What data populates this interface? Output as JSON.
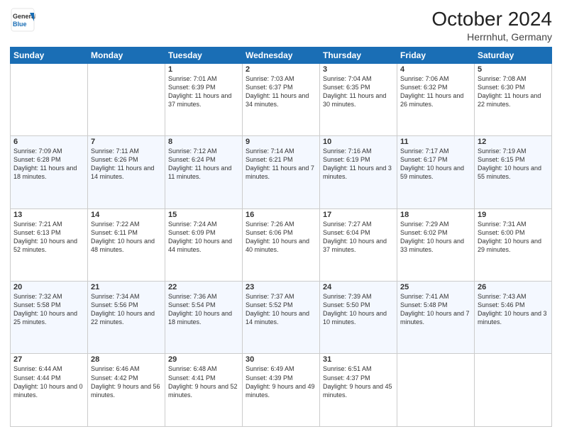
{
  "header": {
    "logo_line1": "General",
    "logo_line2": "Blue",
    "title": "October 2024",
    "location": "Herrnhut, Germany"
  },
  "weekdays": [
    "Sunday",
    "Monday",
    "Tuesday",
    "Wednesday",
    "Thursday",
    "Friday",
    "Saturday"
  ],
  "weeks": [
    [
      {
        "day": "",
        "sunrise": "",
        "sunset": "",
        "daylight": ""
      },
      {
        "day": "",
        "sunrise": "",
        "sunset": "",
        "daylight": ""
      },
      {
        "day": "1",
        "sunrise": "Sunrise: 7:01 AM",
        "sunset": "Sunset: 6:39 PM",
        "daylight": "Daylight: 11 hours and 37 minutes."
      },
      {
        "day": "2",
        "sunrise": "Sunrise: 7:03 AM",
        "sunset": "Sunset: 6:37 PM",
        "daylight": "Daylight: 11 hours and 34 minutes."
      },
      {
        "day": "3",
        "sunrise": "Sunrise: 7:04 AM",
        "sunset": "Sunset: 6:35 PM",
        "daylight": "Daylight: 11 hours and 30 minutes."
      },
      {
        "day": "4",
        "sunrise": "Sunrise: 7:06 AM",
        "sunset": "Sunset: 6:32 PM",
        "daylight": "Daylight: 11 hours and 26 minutes."
      },
      {
        "day": "5",
        "sunrise": "Sunrise: 7:08 AM",
        "sunset": "Sunset: 6:30 PM",
        "daylight": "Daylight: 11 hours and 22 minutes."
      }
    ],
    [
      {
        "day": "6",
        "sunrise": "Sunrise: 7:09 AM",
        "sunset": "Sunset: 6:28 PM",
        "daylight": "Daylight: 11 hours and 18 minutes."
      },
      {
        "day": "7",
        "sunrise": "Sunrise: 7:11 AM",
        "sunset": "Sunset: 6:26 PM",
        "daylight": "Daylight: 11 hours and 14 minutes."
      },
      {
        "day": "8",
        "sunrise": "Sunrise: 7:12 AM",
        "sunset": "Sunset: 6:24 PM",
        "daylight": "Daylight: 11 hours and 11 minutes."
      },
      {
        "day": "9",
        "sunrise": "Sunrise: 7:14 AM",
        "sunset": "Sunset: 6:21 PM",
        "daylight": "Daylight: 11 hours and 7 minutes."
      },
      {
        "day": "10",
        "sunrise": "Sunrise: 7:16 AM",
        "sunset": "Sunset: 6:19 PM",
        "daylight": "Daylight: 11 hours and 3 minutes."
      },
      {
        "day": "11",
        "sunrise": "Sunrise: 7:17 AM",
        "sunset": "Sunset: 6:17 PM",
        "daylight": "Daylight: 10 hours and 59 minutes."
      },
      {
        "day": "12",
        "sunrise": "Sunrise: 7:19 AM",
        "sunset": "Sunset: 6:15 PM",
        "daylight": "Daylight: 10 hours and 55 minutes."
      }
    ],
    [
      {
        "day": "13",
        "sunrise": "Sunrise: 7:21 AM",
        "sunset": "Sunset: 6:13 PM",
        "daylight": "Daylight: 10 hours and 52 minutes."
      },
      {
        "day": "14",
        "sunrise": "Sunrise: 7:22 AM",
        "sunset": "Sunset: 6:11 PM",
        "daylight": "Daylight: 10 hours and 48 minutes."
      },
      {
        "day": "15",
        "sunrise": "Sunrise: 7:24 AM",
        "sunset": "Sunset: 6:09 PM",
        "daylight": "Daylight: 10 hours and 44 minutes."
      },
      {
        "day": "16",
        "sunrise": "Sunrise: 7:26 AM",
        "sunset": "Sunset: 6:06 PM",
        "daylight": "Daylight: 10 hours and 40 minutes."
      },
      {
        "day": "17",
        "sunrise": "Sunrise: 7:27 AM",
        "sunset": "Sunset: 6:04 PM",
        "daylight": "Daylight: 10 hours and 37 minutes."
      },
      {
        "day": "18",
        "sunrise": "Sunrise: 7:29 AM",
        "sunset": "Sunset: 6:02 PM",
        "daylight": "Daylight: 10 hours and 33 minutes."
      },
      {
        "day": "19",
        "sunrise": "Sunrise: 7:31 AM",
        "sunset": "Sunset: 6:00 PM",
        "daylight": "Daylight: 10 hours and 29 minutes."
      }
    ],
    [
      {
        "day": "20",
        "sunrise": "Sunrise: 7:32 AM",
        "sunset": "Sunset: 5:58 PM",
        "daylight": "Daylight: 10 hours and 25 minutes."
      },
      {
        "day": "21",
        "sunrise": "Sunrise: 7:34 AM",
        "sunset": "Sunset: 5:56 PM",
        "daylight": "Daylight: 10 hours and 22 minutes."
      },
      {
        "day": "22",
        "sunrise": "Sunrise: 7:36 AM",
        "sunset": "Sunset: 5:54 PM",
        "daylight": "Daylight: 10 hours and 18 minutes."
      },
      {
        "day": "23",
        "sunrise": "Sunrise: 7:37 AM",
        "sunset": "Sunset: 5:52 PM",
        "daylight": "Daylight: 10 hours and 14 minutes."
      },
      {
        "day": "24",
        "sunrise": "Sunrise: 7:39 AM",
        "sunset": "Sunset: 5:50 PM",
        "daylight": "Daylight: 10 hours and 10 minutes."
      },
      {
        "day": "25",
        "sunrise": "Sunrise: 7:41 AM",
        "sunset": "Sunset: 5:48 PM",
        "daylight": "Daylight: 10 hours and 7 minutes."
      },
      {
        "day": "26",
        "sunrise": "Sunrise: 7:43 AM",
        "sunset": "Sunset: 5:46 PM",
        "daylight": "Daylight: 10 hours and 3 minutes."
      }
    ],
    [
      {
        "day": "27",
        "sunrise": "Sunrise: 6:44 AM",
        "sunset": "Sunset: 4:44 PM",
        "daylight": "Daylight: 10 hours and 0 minutes."
      },
      {
        "day": "28",
        "sunrise": "Sunrise: 6:46 AM",
        "sunset": "Sunset: 4:42 PM",
        "daylight": "Daylight: 9 hours and 56 minutes."
      },
      {
        "day": "29",
        "sunrise": "Sunrise: 6:48 AM",
        "sunset": "Sunset: 4:41 PM",
        "daylight": "Daylight: 9 hours and 52 minutes."
      },
      {
        "day": "30",
        "sunrise": "Sunrise: 6:49 AM",
        "sunset": "Sunset: 4:39 PM",
        "daylight": "Daylight: 9 hours and 49 minutes."
      },
      {
        "day": "31",
        "sunrise": "Sunrise: 6:51 AM",
        "sunset": "Sunset: 4:37 PM",
        "daylight": "Daylight: 9 hours and 45 minutes."
      },
      {
        "day": "",
        "sunrise": "",
        "sunset": "",
        "daylight": ""
      },
      {
        "day": "",
        "sunrise": "",
        "sunset": "",
        "daylight": ""
      }
    ]
  ]
}
